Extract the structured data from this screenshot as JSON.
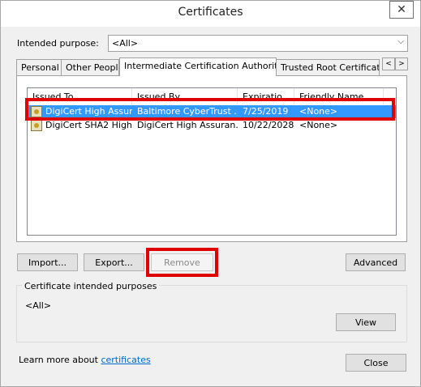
{
  "window": {
    "title": "Certificates",
    "close_glyph": "✕"
  },
  "purpose": {
    "label": "Intended purpose:",
    "value": "<All>"
  },
  "tabs": [
    {
      "label": "Personal"
    },
    {
      "label": "Other People"
    },
    {
      "label": "Intermediate Certification Authorities"
    },
    {
      "label": "Trusted Root Certification"
    }
  ],
  "tab_scroll": {
    "left": "<",
    "right": ">"
  },
  "list": {
    "columns": [
      "Issued To",
      "Issued By",
      "Expiratio...",
      "Friendly Name"
    ],
    "rows": [
      {
        "issued_to": "DigiCert High Assur...",
        "issued_by": "Baltimore CyberTrust ...",
        "expiration": "7/25/2019",
        "friendly_name": "<None>",
        "selected": true
      },
      {
        "issued_to": "DigiCert SHA2 High ...",
        "issued_by": "DigiCert High Assuran...",
        "expiration": "10/22/2028",
        "friendly_name": "<None>",
        "selected": false
      }
    ]
  },
  "buttons": {
    "import": "Import...",
    "export": "Export...",
    "remove": "Remove",
    "advanced": "Advanced",
    "view": "View",
    "close": "Close"
  },
  "intended_purposes": {
    "title": "Certificate intended purposes",
    "value": "<All>"
  },
  "footer": {
    "prefix": "Learn more about ",
    "link": "certificates"
  },
  "colors": {
    "selection": "#3399ff",
    "highlight": "#e00000",
    "link": "#0066cc"
  }
}
